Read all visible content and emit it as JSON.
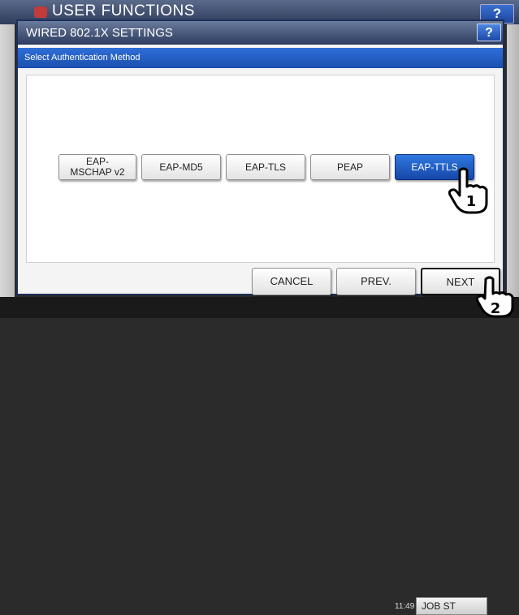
{
  "background": {
    "title": "USER FUNCTIONS",
    "help_label": "?",
    "clock": "11:49",
    "job_status_label": "JOB ST"
  },
  "dialog": {
    "title": "WIRED 802.1X SETTINGS",
    "help_label": "?",
    "subtitle": "Select Authentication Method",
    "methods": [
      {
        "label": "EAP-MSCHAP v2",
        "selected": false
      },
      {
        "label": "EAP-MD5",
        "selected": false
      },
      {
        "label": "EAP-TLS",
        "selected": false
      },
      {
        "label": "PEAP",
        "selected": false
      },
      {
        "label": "EAP-TTLS",
        "selected": true
      }
    ],
    "footer": {
      "cancel": "CANCEL",
      "prev": "PREV.",
      "next": "NEXT"
    }
  },
  "annotations": {
    "step1": "1",
    "step2": "2"
  },
  "colors": {
    "selected_accent": "#1a55c4",
    "title_bar": "#3a4a6e"
  }
}
